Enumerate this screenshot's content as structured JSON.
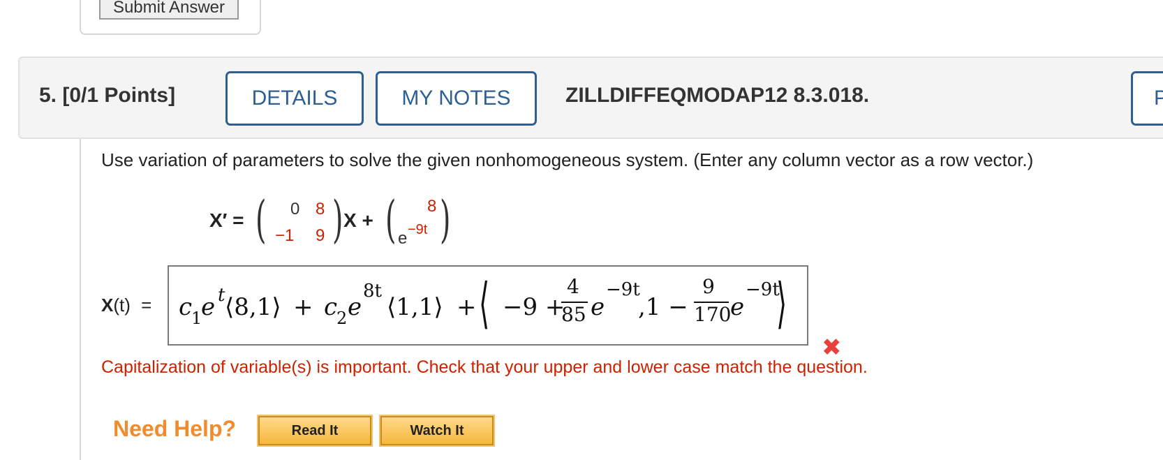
{
  "prev_card": {
    "submit_label": "Submit Answer"
  },
  "question": {
    "number_label": "5.",
    "points_label": "[0/1 Points]",
    "details_label": "DETAILS",
    "notes_label": "MY NOTES",
    "code": "ZILLDIFFEQMODAP12 8.3.018.",
    "right_button_label": "P",
    "prompt": "Use variation of parameters to solve the given nonhomogeneous system. (Enter any column vector as a row vector.)"
  },
  "ode": {
    "lhs": "X′ =",
    "matrix": [
      [
        "0",
        "8"
      ],
      [
        "−1",
        "9"
      ]
    ],
    "mid": "X +",
    "vector": [
      "8",
      "e",
      "−9t"
    ]
  },
  "answer": {
    "label_X": "X",
    "label_t": "(t)",
    "equals": "=",
    "c1": "c",
    "sub1": "1",
    "e1": "e",
    "exp1": "t",
    "vec1": "⟨8,1⟩",
    "plus1": "+",
    "c2": "c",
    "sub2": "2",
    "e2": "e",
    "exp2": "8t",
    "vec2": "⟨1,1⟩",
    "plus2": "+",
    "open": "⟨",
    "term1": "−9 +",
    "frac1_num": "4",
    "frac1_den": "85",
    "e3": "e",
    "exp3": "−9t",
    "comma": ",1 −",
    "frac2_num": "9",
    "frac2_den": "170",
    "e4": "e",
    "exp4": "−9t",
    "close": "⟩"
  },
  "feedback": {
    "wrong_icon": "x-mark-icon",
    "message": "Capitalization of variable(s) is important. Check that your upper and lower case match the question."
  },
  "help": {
    "title": "Need Help?",
    "read_label": "Read It",
    "watch_label": "Watch It"
  },
  "colors": {
    "accent_blue": "#2e5f93",
    "error_red": "#cc2200",
    "help_orange": "#f08c2b"
  }
}
